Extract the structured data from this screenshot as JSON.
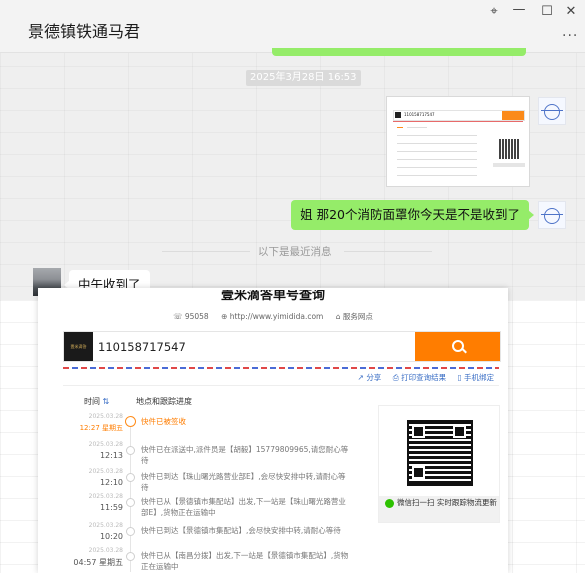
{
  "chat": {
    "title": "景德镇铁通马君",
    "controls": {
      "pin": "⌖",
      "minimize": "—",
      "maximize": "☐",
      "close": "✕",
      "more": "···"
    },
    "timestamp": "2025年3月28日 16:53",
    "my_message": "姐  那20个消防面罩你今天是不是收到了",
    "divider_text": "以下是最近消息",
    "their_message": "中午收到了"
  },
  "tracking": {
    "site_title": "壹米滴答单号查询",
    "info": {
      "phone": "95058",
      "url": "http://www.yimidida.com",
      "service": "服务网点"
    },
    "logo_text": "壹米滴答",
    "tracking_number": "110158717547",
    "actions": [
      "分享",
      "打印查询结果",
      "手机绑定"
    ],
    "columns": {
      "time": "时间",
      "sort_arrows": "⇅",
      "detail": "地点和跟踪进度"
    },
    "events": [
      {
        "date": "2025.03.28",
        "time": "12:27 星期五",
        "text": "快件已被签收"
      },
      {
        "date": "2025.03.28",
        "time": "12:13",
        "text": "快件已在派送中,派件员是【胡毅】15779809965,请您耐心等待"
      },
      {
        "date": "2025.03.28",
        "time": "12:10",
        "text": "快件已到达【珠山曙光路营业部E】,会尽快安排中转,请耐心等待"
      },
      {
        "date": "2025.03.28",
        "time": "11:59",
        "text": "快件已从【景德镇市集配站】出发,下一站是【珠山曙光路营业部E】,货物正在运输中"
      },
      {
        "date": "2025.03.28",
        "time": "10:20",
        "text": "快件已到达【景德镇市集配站】,会尽快安排中转,请耐心等待"
      },
      {
        "date": "2025.03.28",
        "time": "04:57 星期五",
        "text": "快件已从【南昌分拨】出发,下一站是【景德镇市集配站】,货物正在运输中"
      }
    ],
    "qr_caption": "微信扫一扫 实时跟踪物流更新"
  },
  "colors": {
    "accent_orange": "#ff7d00",
    "bubble_green": "#95ec69",
    "link_blue": "#3a6ec5"
  }
}
